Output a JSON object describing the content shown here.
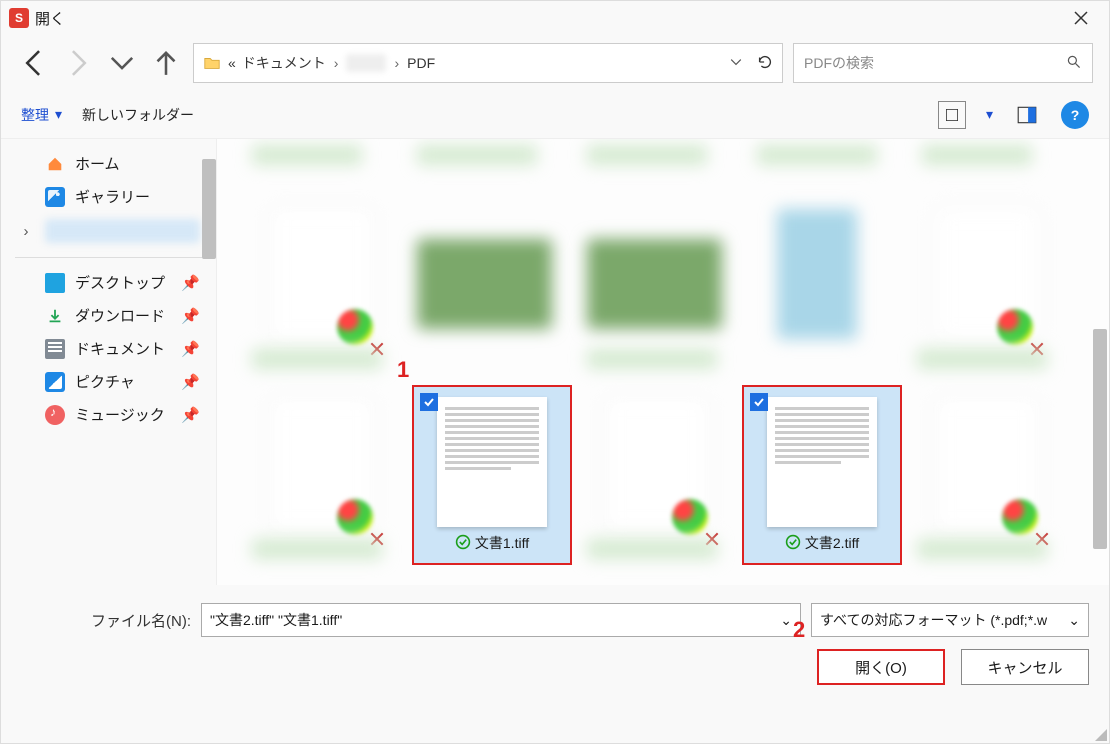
{
  "window": {
    "title": "開く",
    "appicon_letter": "S"
  },
  "breadcrumbs": {
    "prefix": "«",
    "item1": "ドキュメント",
    "item2": "PDF"
  },
  "search": {
    "placeholder": "PDFの検索"
  },
  "toolbar": {
    "organize": "整理",
    "newfolder": "新しいフォルダー",
    "help": "?"
  },
  "sidebar": {
    "home": "ホーム",
    "gallery": "ギャラリー",
    "desktop": "デスクトップ",
    "downloads": "ダウンロード",
    "documents": "ドキュメント",
    "pictures": "ピクチャ",
    "music": "ミュージック"
  },
  "files": {
    "sel1": "文書1.tiff",
    "sel2": "文書2.tiff"
  },
  "annotations": {
    "a1": "1",
    "a2": "2"
  },
  "footer": {
    "filename_label": "ファイル名(N):",
    "filename_value": "\"文書2.tiff\" \"文書1.tiff\"",
    "format_value": "すべての対応フォーマット (*.pdf;*.w",
    "open": "開く(O)",
    "cancel": "キャンセル"
  },
  "glyphs": {
    "chev_r": "›",
    "chev_d": "⌄",
    "pin": "📌"
  }
}
